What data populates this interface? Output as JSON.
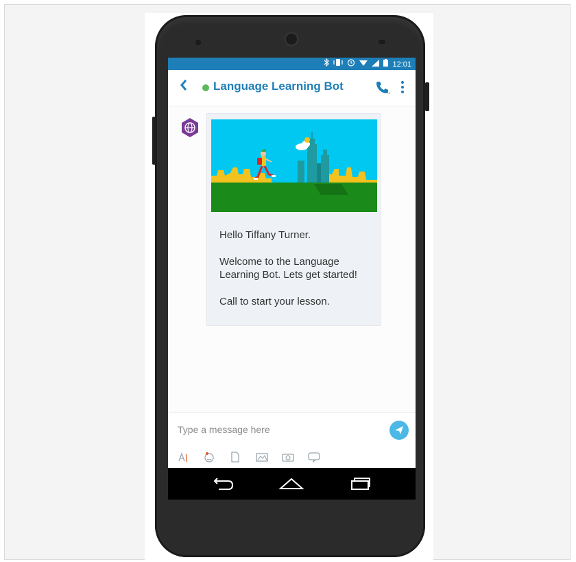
{
  "status_bar": {
    "icons": [
      "bluetooth-icon",
      "vibrate-icon",
      "alarm-icon",
      "wifi-icon",
      "signal-icon",
      "battery-icon"
    ],
    "time": "12:01"
  },
  "header": {
    "title": "Language Learning Bot",
    "presence_color": "#5cb85c",
    "accent_color": "#1e7fb8"
  },
  "message": {
    "greeting": "Hello Tiffany Turner.",
    "welcome": "Welcome to the Language Learning Bot. Lets get started!",
    "instruction": "Call to start your lesson."
  },
  "composer": {
    "placeholder": "Type a message here",
    "tools": [
      "text-format-icon",
      "emoji-icon",
      "file-icon",
      "image-icon",
      "camera-icon",
      "chat-icon"
    ]
  },
  "navigation": {
    "buttons": [
      "back-icon",
      "home-icon",
      "recents-icon"
    ]
  }
}
